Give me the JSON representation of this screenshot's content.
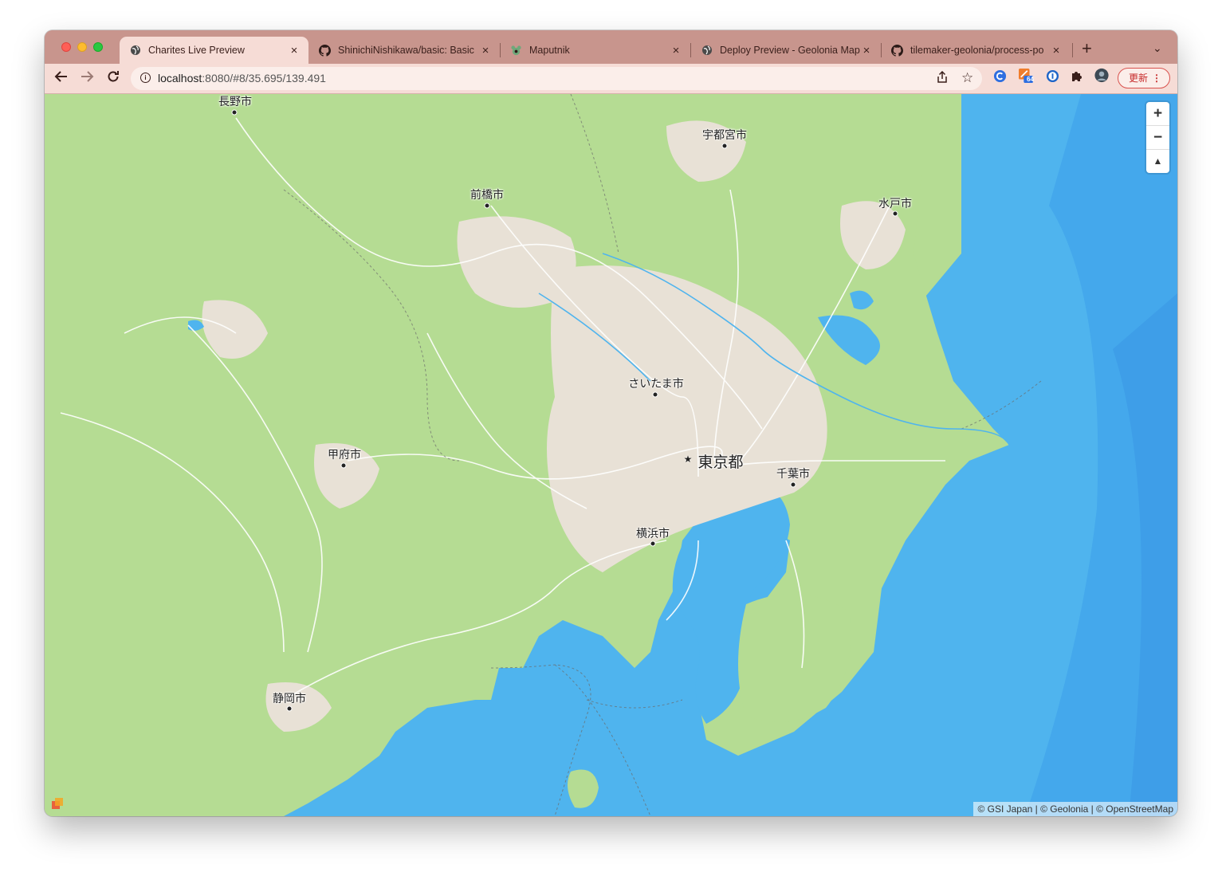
{
  "browser": {
    "tabs": [
      {
        "title": "Charites Live Preview",
        "icon": "globe-icon",
        "active": true
      },
      {
        "title": "ShinichiNishikawa/basic: Basic",
        "icon": "github-icon",
        "active": false
      },
      {
        "title": "Maputnik",
        "icon": "maputnik-icon",
        "active": false
      },
      {
        "title": "Deploy Preview - Geolonia Map",
        "icon": "globe-icon",
        "active": false
      },
      {
        "title": "tilemaker-geolonia/process-po",
        "icon": "github-icon",
        "active": false
      }
    ],
    "url_host": "localhost",
    "url_rest": ":8080/#8/35.695/139.491",
    "update_label": "更新",
    "extension_badge": "64"
  },
  "map": {
    "cities": [
      {
        "name": "長野市"
      },
      {
        "name": "宇都宮市"
      },
      {
        "name": "前橋市"
      },
      {
        "name": "水戸市"
      },
      {
        "name": "さいたま市"
      },
      {
        "name": "甲府市"
      },
      {
        "name": "東京都"
      },
      {
        "name": "千葉市"
      },
      {
        "name": "横浜市"
      },
      {
        "name": "静岡市"
      }
    ],
    "zoom_in": "+",
    "zoom_out": "−",
    "compass": "▲",
    "attribution": "© GSI Japan | © Geolonia | © OpenStreetMap",
    "colors": {
      "land": "#b5dc93",
      "urban": "#e8e1d6",
      "sea": "#5bbff0",
      "deep_sea": "#3e9ee8"
    }
  }
}
